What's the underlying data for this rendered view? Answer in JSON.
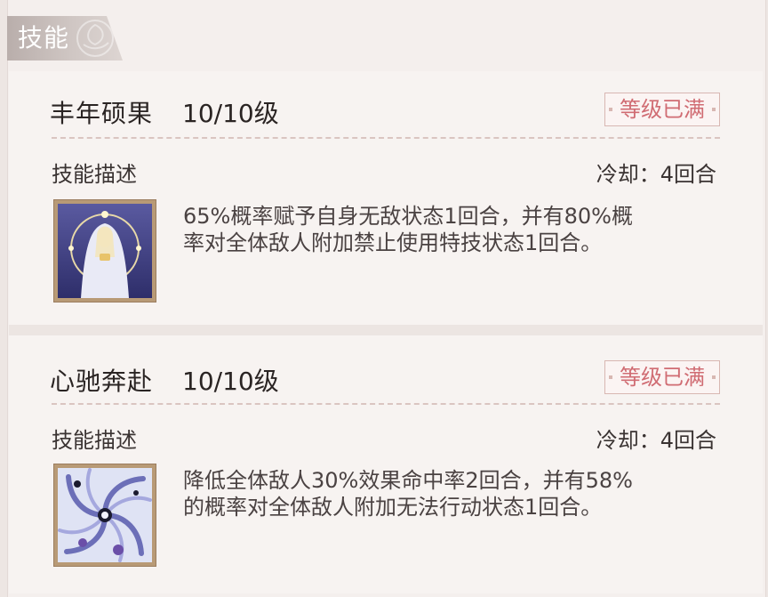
{
  "header": {
    "title": "技能"
  },
  "skills": [
    {
      "name": "丰年硕果",
      "level": "10/10级",
      "badge": "等级已满",
      "desc_label": "技能描述",
      "cooldown": "冷却：4回合",
      "text_line1": "65%概率赋予自身无敌状态1回合，并有80%概",
      "text_line2": "率对全体敌人附加禁止使用特技状态1回合。",
      "icon": "goddess-portrait-icon"
    },
    {
      "name": "心驰奔赴",
      "level": "10/10级",
      "badge": "等级已满",
      "desc_label": "技能描述",
      "cooldown": "冷却：4回合",
      "text_line1": "降低全体敌人30%效果命中率2回合，并有58%",
      "text_line2": "的概率对全体敌人附加无法行动状态1回合。",
      "icon": "vortex-icon"
    }
  ],
  "colors": {
    "badge_text": "#d06c73",
    "badge_border": "#d8b7b2",
    "icon_frame": "#b89a76",
    "text": "#2a2423"
  }
}
